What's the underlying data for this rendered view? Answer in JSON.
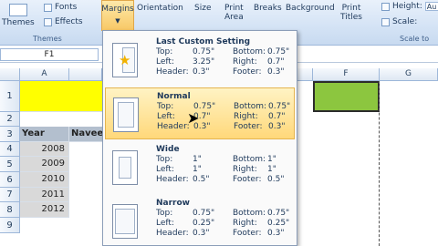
{
  "ribbon": {
    "themes": "Themes",
    "fonts": "Fonts",
    "effects": "Effects",
    "themes_group": "Themes",
    "margins": "Margins",
    "orientation": "Orientation",
    "size": "Size",
    "print_area": "Print\nArea",
    "breaks": "Breaks",
    "background": "Background",
    "print_titles": "Print\nTitles",
    "height_label": "Height:",
    "height_value": "Au",
    "scale_label": "Scale:",
    "scale_to_group": "Scale to"
  },
  "formula_bar": {
    "name_box": "F1"
  },
  "sheet": {
    "columns": [
      "A",
      "F",
      "G"
    ],
    "rows": [
      "1",
      "2",
      "3",
      "4",
      "5",
      "6",
      "7",
      "8",
      "9"
    ],
    "header_year": "Year",
    "header_navee": "Navee",
    "years": [
      "2008",
      "2009",
      "2010",
      "2011",
      "2012"
    ]
  },
  "margins_menu": {
    "options": [
      {
        "title": "Last Custom Setting",
        "top": "Top:",
        "top_v": "0.75\"",
        "bottom": "Bottom:",
        "bottom_v": "0.75\"",
        "left": "Left:",
        "left_v": "3.25\"",
        "right": "Right:",
        "right_v": "0.7\"",
        "header": "Header:",
        "header_v": "0.3\"",
        "footer": "Footer:",
        "footer_v": "0.3\""
      },
      {
        "title": "Normal",
        "top": "Top:",
        "top_v": "0.75\"",
        "bottom": "Bottom:",
        "bottom_v": "0.75\"",
        "left": "Left:",
        "left_v": "0.7\"",
        "right": "Right:",
        "right_v": "0.7\"",
        "header": "Header:",
        "header_v": "0.3\"",
        "footer": "Footer:",
        "footer_v": "0.3\""
      },
      {
        "title": "Wide",
        "top": "Top:",
        "top_v": "1\"",
        "bottom": "Bottom:",
        "bottom_v": "1\"",
        "left": "Left:",
        "left_v": "1\"",
        "right": "Right:",
        "right_v": "1\"",
        "header": "Header:",
        "header_v": "0.5\"",
        "footer": "Footer:",
        "footer_v": "0.5\""
      },
      {
        "title": "Narrow",
        "top": "Top:",
        "top_v": "0.75\"",
        "bottom": "Bottom:",
        "bottom_v": "0.75\"",
        "left": "Left:",
        "left_v": "0.25\"",
        "right": "Right:",
        "right_v": "0.25\"",
        "header": "Header:",
        "header_v": "0.3\"",
        "footer": "Footer:",
        "footer_v": "0.3\""
      }
    ]
  },
  "colors": {
    "accent": "#f8c866",
    "selected_fill": "#8cc63f",
    "highlight": "#ffff00"
  }
}
